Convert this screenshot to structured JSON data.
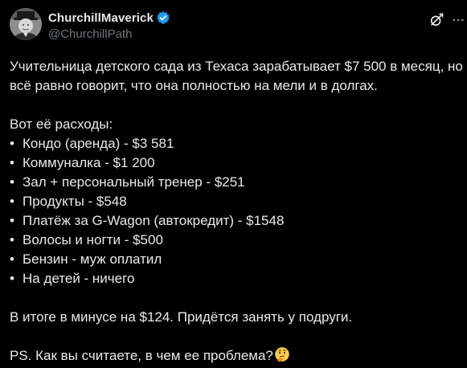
{
  "author": {
    "display_name": "ChurchillMaverick",
    "handle": "@ChurchillPath",
    "verified_color": "#1d9bf0"
  },
  "actions": {
    "grok_icon": "grok-icon",
    "more_icon": "more-icon"
  },
  "tweet": {
    "intro_line1": "Учительница детского сада из Техаса зарабатывает $7 500 в месяц, но",
    "intro_line2": "всё равно говорит, что она полностью на мели и в долгах.",
    "expenses_heading": "Вот её расходы:",
    "bullet_symbol": "•",
    "expenses": [
      "Кондо (аренда) - $3 581",
      "Коммуналка - $1 200",
      "Зал + персональный тренер - $251",
      "Продукты - $548",
      "Платёж за G-Wagon (автокредит) - $1548",
      "Волосы и ногти - $500",
      "Бензин - муж оплатил",
      "На детей - ничего"
    ],
    "summary": "В итоге в минусе на $124. Придётся занять у подруги.",
    "ps": "PS. Как вы считаете, в чем ее проблема?",
    "ps_emoji": "thinking-face-emoji"
  },
  "colors": {
    "background": "#000000",
    "text": "#e7e9ea",
    "secondary_text": "#71767b",
    "accent": "#1d9bf0"
  }
}
